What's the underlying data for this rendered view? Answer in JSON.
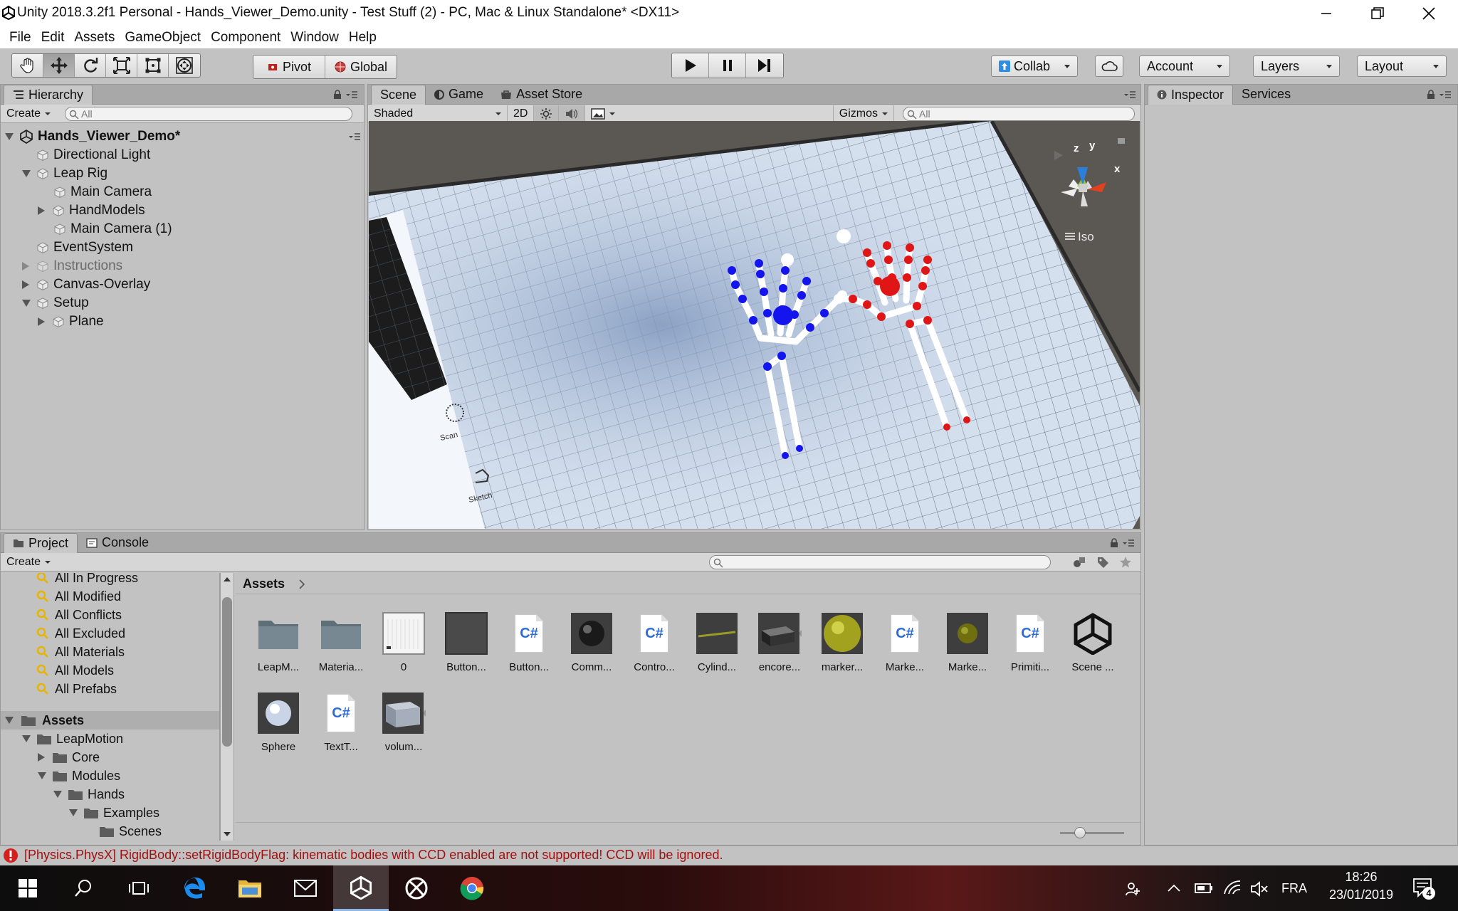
{
  "window": {
    "title": "Unity 2018.3.2f1 Personal - Hands_Viewer_Demo.unity - Test Stuff (2) - PC, Mac & Linux Standalone* <DX11>"
  },
  "menu": [
    "File",
    "Edit",
    "Assets",
    "GameObject",
    "Component",
    "Window",
    "Help"
  ],
  "toolbar": {
    "pivot": "Pivot",
    "global": "Global",
    "collab": "Collab",
    "account": "Account",
    "layers": "Layers",
    "layout": "Layout"
  },
  "hierarchy": {
    "tab": "Hierarchy",
    "create": "Create",
    "search_placeholder": "All",
    "scene_name": "Hands_Viewer_Demo*",
    "items": [
      {
        "label": "Directional Light"
      },
      {
        "label": "Leap Rig"
      },
      {
        "label": "Main Camera"
      },
      {
        "label": "HandModels"
      },
      {
        "label": "Main Camera (1)"
      },
      {
        "label": "EventSystem"
      },
      {
        "label": "Instructions"
      },
      {
        "label": "Canvas-Overlay"
      },
      {
        "label": "Setup"
      },
      {
        "label": "Plane"
      }
    ]
  },
  "scene": {
    "tabs": [
      "Scene",
      "Game",
      "Asset Store"
    ],
    "shading": "Shaded",
    "mode_2d": "2D",
    "gizmos": "Gizmos",
    "search_placeholder": "All",
    "iso": "Iso",
    "axis_x": "x",
    "axis_y": "y",
    "axis_z": "z",
    "label_scan": "Scan",
    "label_sketch": "Sketch"
  },
  "inspector": {
    "tabs": [
      "Inspector",
      "Services"
    ]
  },
  "project": {
    "tabs": [
      "Project",
      "Console"
    ],
    "create": "Create",
    "favorites": [
      "All In Progress",
      "All Modified",
      "All Conflicts",
      "All Excluded",
      "All Materials",
      "All Models",
      "All Prefabs"
    ],
    "tree": [
      "Assets",
      "LeapMotion",
      "Core",
      "Modules",
      "Hands",
      "Examples",
      "Scenes"
    ],
    "breadcrumb": "Assets",
    "assets": [
      {
        "label": "LeapM...",
        "kind": "folder"
      },
      {
        "label": "Materia...",
        "kind": "folder"
      },
      {
        "label": "0",
        "kind": "texture"
      },
      {
        "label": "Button...",
        "kind": "dark"
      },
      {
        "label": "Button...",
        "kind": "script"
      },
      {
        "label": "Comm...",
        "kind": "sphere-dark"
      },
      {
        "label": "Contro...",
        "kind": "script"
      },
      {
        "label": "Cylind...",
        "kind": "line"
      },
      {
        "label": "encore...",
        "kind": "box"
      },
      {
        "label": "marker...",
        "kind": "sphere-olive"
      },
      {
        "label": "Marke...",
        "kind": "script"
      },
      {
        "label": "Marke...",
        "kind": "sphere-small"
      },
      {
        "label": "Primiti...",
        "kind": "script"
      },
      {
        "label": "Scene ...",
        "kind": "unity"
      },
      {
        "label": "Sphere",
        "kind": "sphere-white"
      },
      {
        "label": "TextT...",
        "kind": "script"
      },
      {
        "label": "volum...",
        "kind": "volume"
      }
    ]
  },
  "status": {
    "message": "[Physics.PhysX] RigidBody::setRigidBodyFlag: kinematic bodies with CCD enabled are not supported! CCD will be ignored."
  },
  "taskbar": {
    "language": "FRA",
    "time": "18:26",
    "date": "23/01/2019",
    "notifications": "4"
  }
}
